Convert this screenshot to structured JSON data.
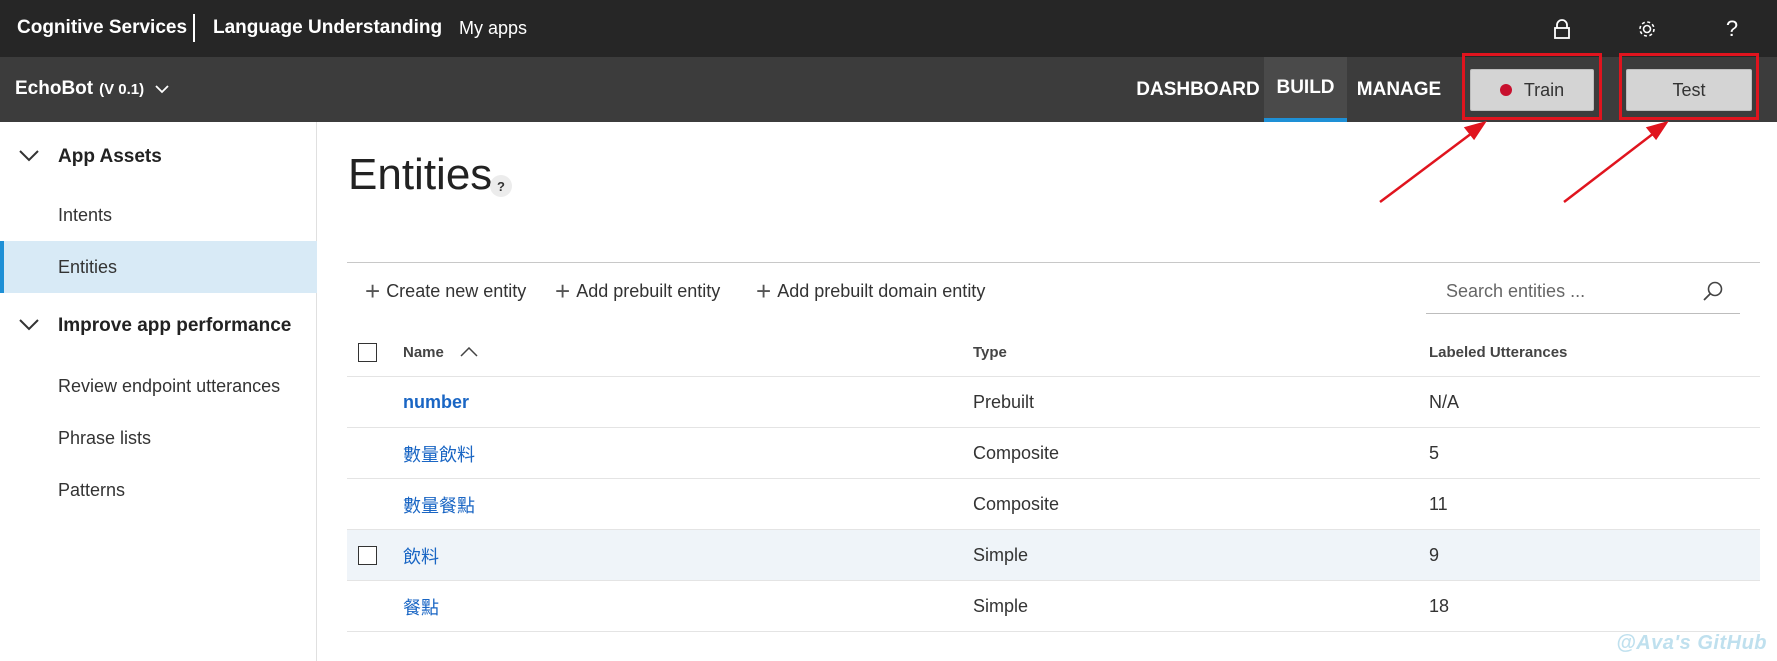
{
  "topbar": {
    "brand": "Cognitive Services",
    "product": "Language Understanding",
    "my_apps": "My apps",
    "icons": [
      "lock-icon",
      "gear-icon",
      "help-icon"
    ],
    "help_glyph": "?"
  },
  "appbar": {
    "app_name": "EchoBot",
    "version": "(V 0.1)",
    "tabs": [
      {
        "label": "DASHBOARD",
        "active": false
      },
      {
        "label": "BUILD",
        "active": true
      },
      {
        "label": "MANAGE",
        "active": false
      }
    ],
    "train_label": "Train",
    "test_label": "Test",
    "accent_color": "#1e90d6",
    "train_dot_color": "#c8102e"
  },
  "sidebar": {
    "groups": [
      {
        "label": "App Assets",
        "items": [
          "Intents",
          "Entities"
        ]
      },
      {
        "label": "Improve app performance",
        "items": [
          "Review endpoint utterances",
          "Phrase lists",
          "Patterns"
        ]
      }
    ],
    "active_item": "Entities"
  },
  "main": {
    "title": "Entities",
    "help_glyph": "?",
    "commands": [
      "Create new entity",
      "Add prebuilt entity",
      "Add prebuilt domain entity"
    ],
    "search_placeholder": "Search entities ...",
    "columns": [
      "Name",
      "Type",
      "Labeled Utterances"
    ],
    "rows": [
      {
        "name": "number",
        "type": "Prebuilt",
        "utterances": "N/A"
      },
      {
        "name": "數量飲料",
        "type": "Composite",
        "utterances": "5"
      },
      {
        "name": "數量餐點",
        "type": "Composite",
        "utterances": "11"
      },
      {
        "name": "飲料",
        "type": "Simple",
        "utterances": "9"
      },
      {
        "name": "餐點",
        "type": "Simple",
        "utterances": "18"
      }
    ]
  },
  "watermark": "@Ava's GitHub"
}
